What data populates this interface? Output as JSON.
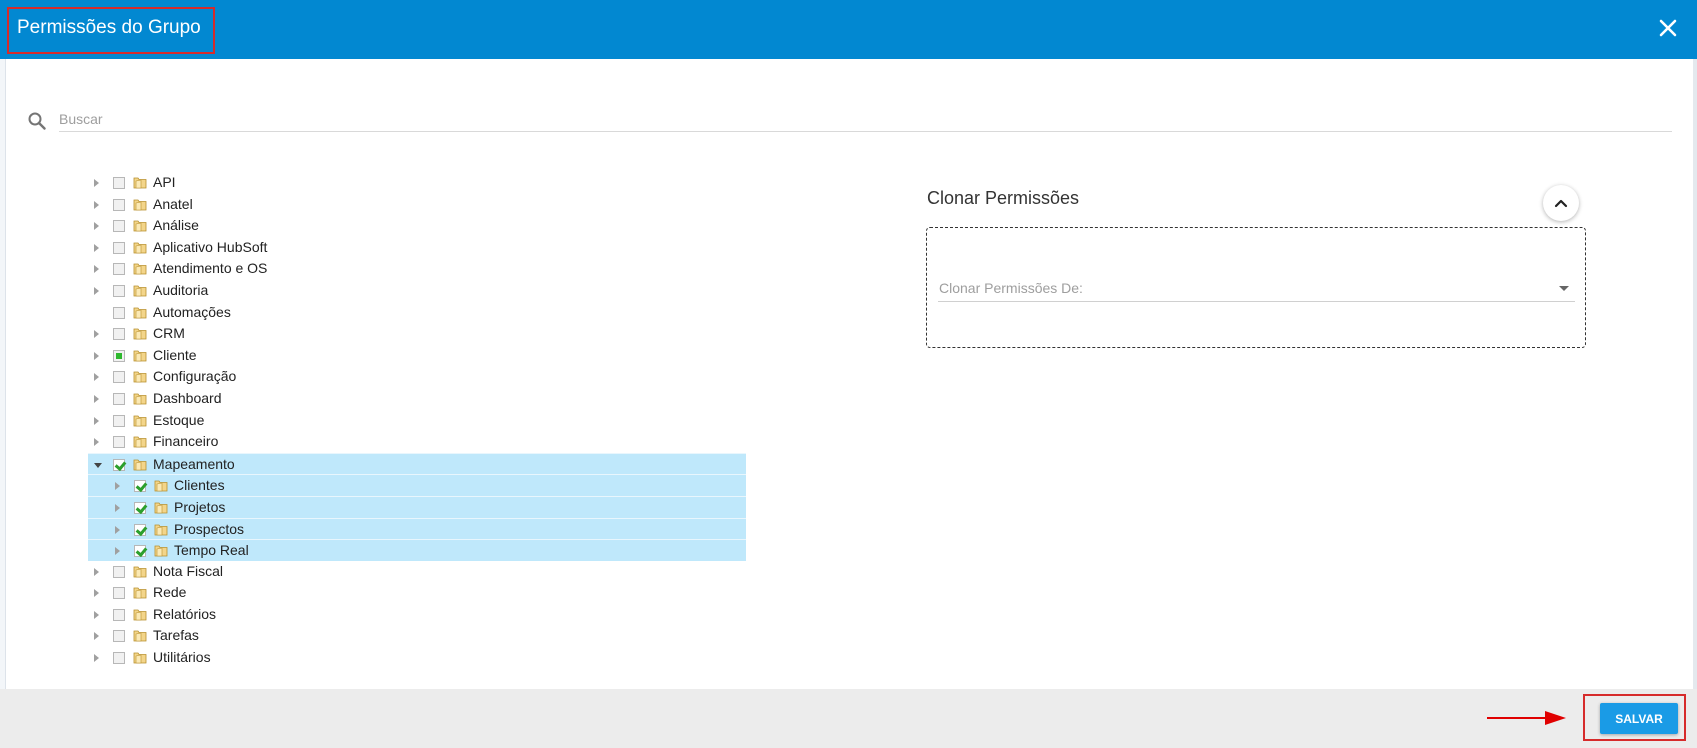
{
  "dialog": {
    "title": "Permissões do Grupo",
    "close_icon": "close-icon"
  },
  "search": {
    "placeholder": "Buscar",
    "value": "",
    "icon": "search-icon"
  },
  "tree": [
    {
      "label": "API",
      "level": 0,
      "expander": "collapsed",
      "check": "unchecked"
    },
    {
      "label": "Anatel",
      "level": 0,
      "expander": "collapsed",
      "check": "unchecked"
    },
    {
      "label": "Análise",
      "level": 0,
      "expander": "collapsed",
      "check": "unchecked"
    },
    {
      "label": "Aplicativo HubSoft",
      "level": 0,
      "expander": "collapsed",
      "check": "unchecked"
    },
    {
      "label": "Atendimento e OS",
      "level": 0,
      "expander": "collapsed",
      "check": "unchecked"
    },
    {
      "label": "Auditoria",
      "level": 0,
      "expander": "collapsed",
      "check": "unchecked"
    },
    {
      "label": "Automações",
      "level": 0,
      "expander": "none",
      "check": "unchecked"
    },
    {
      "label": "CRM",
      "level": 0,
      "expander": "collapsed",
      "check": "unchecked"
    },
    {
      "label": "Cliente",
      "level": 0,
      "expander": "collapsed",
      "check": "partial"
    },
    {
      "label": "Configuração",
      "level": 0,
      "expander": "collapsed",
      "check": "unchecked"
    },
    {
      "label": "Dashboard",
      "level": 0,
      "expander": "collapsed",
      "check": "unchecked"
    },
    {
      "label": "Estoque",
      "level": 0,
      "expander": "collapsed",
      "check": "unchecked"
    },
    {
      "label": "Financeiro",
      "level": 0,
      "expander": "collapsed",
      "check": "unchecked"
    },
    {
      "label": "Mapeamento",
      "level": 0,
      "expander": "expanded",
      "check": "checked",
      "selected": true
    },
    {
      "label": "Clientes",
      "level": 1,
      "expander": "collapsed",
      "check": "checked",
      "selected": true
    },
    {
      "label": "Projetos",
      "level": 1,
      "expander": "collapsed",
      "check": "checked",
      "selected": true
    },
    {
      "label": "Prospectos",
      "level": 1,
      "expander": "collapsed",
      "check": "checked",
      "selected": true
    },
    {
      "label": "Tempo Real",
      "level": 1,
      "expander": "collapsed",
      "check": "checked",
      "selected": true
    },
    {
      "label": "Nota Fiscal",
      "level": 0,
      "expander": "collapsed",
      "check": "unchecked"
    },
    {
      "label": "Rede",
      "level": 0,
      "expander": "collapsed",
      "check": "unchecked"
    },
    {
      "label": "Relatórios",
      "level": 0,
      "expander": "collapsed",
      "check": "unchecked"
    },
    {
      "label": "Tarefas",
      "level": 0,
      "expander": "collapsed",
      "check": "unchecked"
    },
    {
      "label": "Utilitários",
      "level": 0,
      "expander": "collapsed",
      "check": "unchecked"
    }
  ],
  "clone": {
    "title": "Clonar Permissões",
    "select_placeholder": "Clonar Permissões De:",
    "collapse_icon": "chevron-up-icon"
  },
  "footer": {
    "save_label": "SALVAR"
  },
  "colors": {
    "header": "#0288d1",
    "save_button": "#1a9be6",
    "selection": "#bfe8fb",
    "highlight_box": "#d62b2b",
    "arrow": "#e00000"
  }
}
